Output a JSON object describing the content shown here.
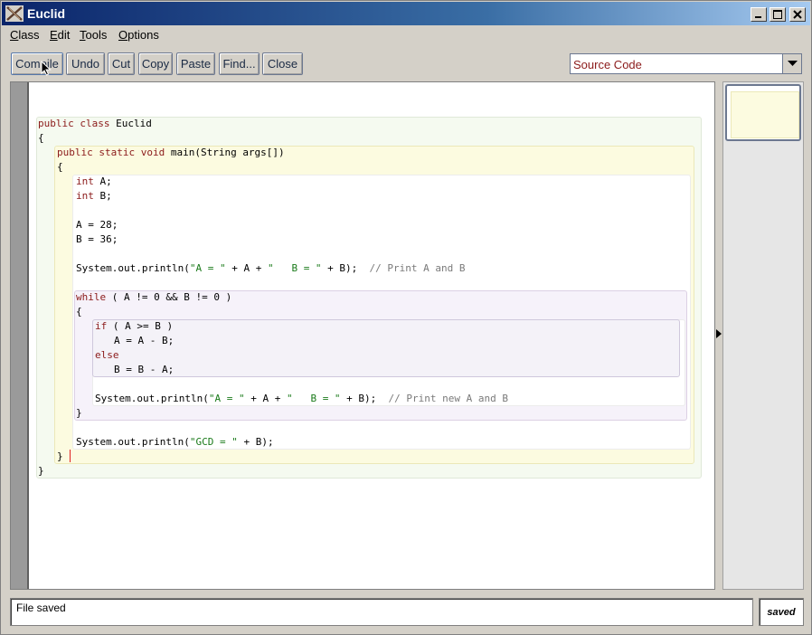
{
  "window": {
    "title": "Euclid"
  },
  "menu": [
    "Class",
    "Edit",
    "Tools",
    "Options"
  ],
  "toolbar": {
    "buttons": [
      "Compile",
      "Undo",
      "Cut",
      "Copy",
      "Paste",
      "Find...",
      "Close"
    ],
    "view_select": "Source Code"
  },
  "code": {
    "lines": [
      {
        "parts": [
          {
            "t": "public class ",
            "c": "kw"
          },
          {
            "t": "Euclid",
            "c": ""
          }
        ]
      },
      {
        "parts": [
          {
            "t": "{",
            "c": ""
          }
        ]
      },
      {
        "parts": [
          {
            "t": "public static void ",
            "c": "kw"
          },
          {
            "t": "main(String args[])",
            "c": ""
          }
        ]
      },
      {
        "parts": [
          {
            "t": "{",
            "c": ""
          }
        ]
      },
      {
        "parts": [
          {
            "t": "int ",
            "c": "kw"
          },
          {
            "t": "A;",
            "c": ""
          }
        ]
      },
      {
        "parts": [
          {
            "t": "int ",
            "c": "kw"
          },
          {
            "t": "B;",
            "c": ""
          }
        ]
      },
      {
        "parts": [
          {
            "t": "A = 28;",
            "c": ""
          }
        ]
      },
      {
        "parts": [
          {
            "t": "B = 36;",
            "c": ""
          }
        ]
      },
      {
        "parts": [
          {
            "t": "System.out.println(",
            "c": ""
          },
          {
            "t": "\"A = \"",
            "c": "str"
          },
          {
            "t": " + A + ",
            "c": ""
          },
          {
            "t": "\"   B = \"",
            "c": "str"
          },
          {
            "t": " + B);  ",
            "c": ""
          },
          {
            "t": "// Print A and B",
            "c": "cm"
          }
        ]
      },
      {
        "parts": [
          {
            "t": "while",
            "c": "kw"
          },
          {
            "t": " ( A != 0 && B != 0 )",
            "c": ""
          }
        ]
      },
      {
        "parts": [
          {
            "t": "{",
            "c": ""
          }
        ]
      },
      {
        "parts": [
          {
            "t": "if",
            "c": "kw"
          },
          {
            "t": " ( A >= B )",
            "c": ""
          }
        ]
      },
      {
        "parts": [
          {
            "t": "A = A - B;",
            "c": ""
          }
        ]
      },
      {
        "parts": [
          {
            "t": "else",
            "c": "kw"
          }
        ]
      },
      {
        "parts": [
          {
            "t": "B = B - A;",
            "c": ""
          }
        ]
      },
      {
        "parts": [
          {
            "t": "System.out.println(",
            "c": ""
          },
          {
            "t": "\"A = \"",
            "c": "str"
          },
          {
            "t": " + A + ",
            "c": ""
          },
          {
            "t": "\"   B = \"",
            "c": "str"
          },
          {
            "t": " + B);  ",
            "c": ""
          },
          {
            "t": "// Print new A and B",
            "c": "cm"
          }
        ]
      },
      {
        "parts": [
          {
            "t": "}",
            "c": ""
          }
        ]
      },
      {
        "parts": [
          {
            "t": "System.out.println(",
            "c": ""
          },
          {
            "t": "\"GCD = \"",
            "c": "str"
          },
          {
            "t": " + B);",
            "c": ""
          }
        ]
      },
      {
        "parts": [
          {
            "t": "}",
            "c": ""
          }
        ]
      },
      {
        "parts": [
          {
            "t": "}",
            "c": ""
          }
        ]
      }
    ]
  },
  "status": {
    "message": "File saved",
    "state": "saved"
  },
  "colors": {
    "keyword": "#8b1a1a",
    "string": "#1a7a1a",
    "comment": "#7a7a7a",
    "title_bar": "#0a246a"
  },
  "icons": [
    "euclid-app-icon",
    "minimize-icon",
    "maximize-icon",
    "close-icon",
    "chevron-down-icon",
    "expand-arrow-icon",
    "mouse-pointer-icon"
  ]
}
